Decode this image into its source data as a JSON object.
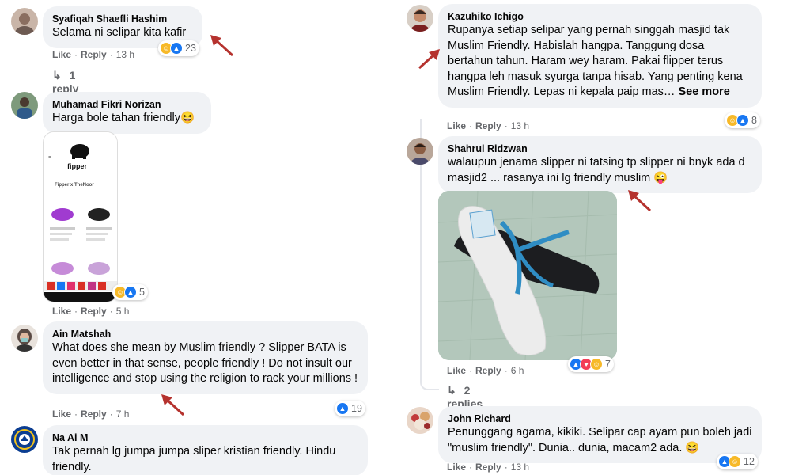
{
  "comments": {
    "c1": {
      "author": "Syafiqah Shaefli Hashim",
      "text": "Selama ni selipar kita kafir",
      "like": "Like",
      "reply": "Reply",
      "time": "13 h",
      "reaction_count": "23",
      "replies_label": "1 reply"
    },
    "c2": {
      "author": "Muhamad Fikri Norizan",
      "text": "Harga bole tahan friendly😆",
      "like": "Like",
      "reply": "Reply",
      "time": "5 h",
      "reaction_count": "5",
      "screenshot": {
        "brand": "fipper",
        "title": "Fipper x TheNoor"
      }
    },
    "c3": {
      "author": "Ain Matshah",
      "text": "What does she mean by Muslim friendly ? Slipper BATA is even better in that sense, people friendly ! Do not insult our intelligence and stop using the religion to rack your millions !",
      "like": "Like",
      "reply": "Reply",
      "time": "7 h",
      "reaction_count": "19"
    },
    "c4": {
      "author": "Na Ai M",
      "text": "Tak pernah lg jumpa jumpa sliper kristian friendly. Hindu friendly."
    },
    "c5": {
      "author": "Kazuhiko Ichigo",
      "text": "Rupanya setiap selipar yang pernah singgah masjid tak Muslim Friendly. Habislah hangpa. Tanggung dosa bertahun tahun. Haram wey haram. Pakai flipper terus hangpa leh masuk syurga tanpa hisab. Yang penting kena Muslim Friendly. Lepas ni kepala paip mas… ",
      "see_more": "See more",
      "like": "Like",
      "reply": "Reply",
      "time": "13 h",
      "reaction_count": "8"
    },
    "c6": {
      "author": "Shahrul Ridzwan",
      "text": "walaupun jenama slipper ni tatsing tp slipper ni bnyk ada d masjid2 ... rasanya ini lg friendly muslim 😜",
      "like": "Like",
      "reply": "Reply",
      "time": "6 h",
      "reaction_count": "7",
      "replies_label": "2 replies"
    },
    "c7": {
      "author": "John Richard",
      "text": "Penunggang agama, kikiki. Selipar cap ayam pun boleh jadi \"muslim friendly\". Dunia.. dunia, macam2 ada. 😆",
      "like": "Like",
      "reply": "Reply",
      "time": "13 h",
      "reaction_count": "12"
    }
  },
  "colors": {
    "bubble": "#f0f2f5",
    "meta": "#65676b",
    "like_blue": "#1877f2",
    "haha_yellow": "#f7b928",
    "love_red": "#f33e58",
    "arrow": "#b5322e"
  },
  "icons": [
    "reply-arrow-icon",
    "like-reaction-icon",
    "haha-reaction-icon",
    "love-reaction-icon",
    "annotation-arrow-icon"
  ]
}
